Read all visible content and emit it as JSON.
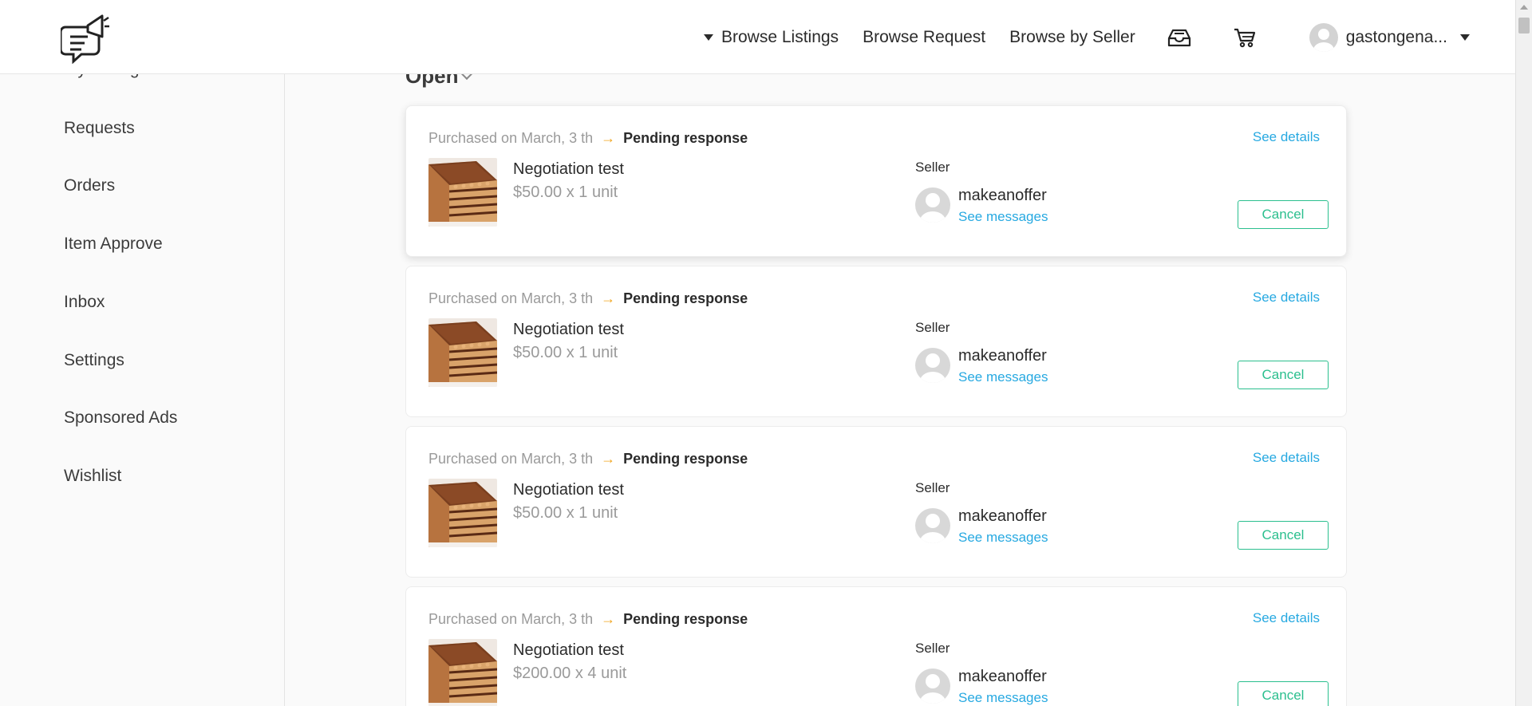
{
  "header": {
    "nav": [
      {
        "label": "Browse Listings",
        "has_caret": true
      },
      {
        "label": "Browse Request"
      },
      {
        "label": "Browse by Seller"
      }
    ],
    "icons": [
      "inbox-tray-icon",
      "cart-icon"
    ],
    "user_name": "gastongena..."
  },
  "sidebar": {
    "items": [
      {
        "label": "My Listings"
      },
      {
        "label": "Requests"
      },
      {
        "label": "Orders"
      },
      {
        "label": "Item Approve"
      },
      {
        "label": "Inbox"
      },
      {
        "label": "Settings"
      },
      {
        "label": "Sponsored Ads"
      },
      {
        "label": "Wishlist"
      }
    ]
  },
  "main": {
    "section_title": "Open",
    "orders": [
      {
        "purchased": "Purchased on March, 3 th",
        "status": "Pending response",
        "see_details": "See details",
        "title": "Negotiation test",
        "price": "$50.00 x 1 unit",
        "seller_label": "Seller",
        "seller_name": "makeanoffer",
        "see_messages": "See messages",
        "cancel": "Cancel"
      },
      {
        "purchased": "Purchased on March, 3 th",
        "status": "Pending response",
        "see_details": "See details",
        "title": "Negotiation test",
        "price": "$50.00 x 1 unit",
        "seller_label": "Seller",
        "seller_name": "makeanoffer",
        "see_messages": "See messages",
        "cancel": "Cancel"
      },
      {
        "purchased": "Purchased on March, 3 th",
        "status": "Pending response",
        "see_details": "See details",
        "title": "Negotiation test",
        "price": "$50.00 x 1 unit",
        "seller_label": "Seller",
        "seller_name": "makeanoffer",
        "see_messages": "See messages",
        "cancel": "Cancel"
      },
      {
        "purchased": "Purchased on March, 3 th",
        "status": "Pending response",
        "see_details": "See details",
        "title": "Negotiation test",
        "price": "$200.00 x 4 unit",
        "seller_label": "Seller",
        "seller_name": "makeanoffer",
        "see_messages": "See messages",
        "cancel": "Cancel"
      }
    ]
  },
  "colors": {
    "link": "#27a9e1",
    "accent_green": "#2bbf8e",
    "arrow": "#f0a51e"
  }
}
